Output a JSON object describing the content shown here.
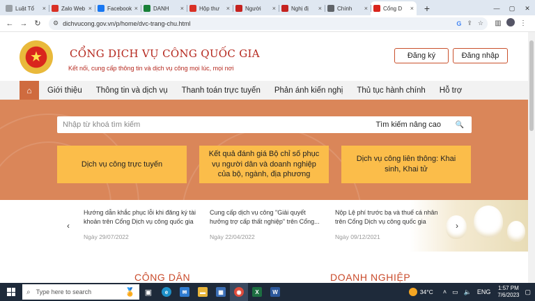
{
  "browser": {
    "tabs": [
      {
        "label": "Luật Tổ",
        "icon": "document-icon",
        "color": "#9aa0a6"
      },
      {
        "label": "Zalo Web",
        "icon": "zalo-icon",
        "color": "#d93025"
      },
      {
        "label": "Facebook",
        "icon": "facebook-icon",
        "color": "#1877f2"
      },
      {
        "label": "DANH",
        "icon": "sheets-icon",
        "color": "#188038"
      },
      {
        "label": "Hộp thư",
        "icon": "gmail-icon",
        "color": "#d93025"
      },
      {
        "label": "Người",
        "icon": "block-icon",
        "color": "#c5221f"
      },
      {
        "label": "Nghị đị",
        "icon": "block-icon",
        "color": "#c5221f"
      },
      {
        "label": "Chính",
        "icon": "globe-icon",
        "color": "#5f6368"
      },
      {
        "label": "Cổng D",
        "icon": "emblem-icon",
        "color": "#d9251d",
        "active": true
      }
    ],
    "new_tab": "+",
    "url": "dichvucong.gov.vn/p/home/dvc-trang-chu.html"
  },
  "site": {
    "brand": {
      "title": "CỔNG DỊCH VỤ CÔNG QUỐC GIA",
      "tagline": "Kết nối, cung cấp thông tin và dịch vụ công mọi lúc, mọi nơi"
    },
    "auth": {
      "register": "Đăng ký",
      "login": "Đăng nhập"
    },
    "nav": [
      "Giới thiệu",
      "Thông tin và dịch vụ",
      "Thanh toán trực tuyến",
      "Phản ánh kiến nghị",
      "Thủ tục hành chính",
      "Hỗ trợ"
    ],
    "search": {
      "placeholder": "Nhập từ khoá tìm kiếm",
      "advanced": "Tìm kiếm nâng cao"
    },
    "cards": [
      "Dịch vụ công trực tuyến",
      "Kết quả đánh giá Bộ chỉ số phục vụ người dân và doanh nghiệp của bộ, ngành, địa phương",
      "Dịch vụ công liên thông: Khai sinh, Khai tử"
    ],
    "news": [
      {
        "title": "Hướng dẫn khắc phục lỗi khi đăng ký tài khoản trên Cổng Dịch vụ công quốc gia",
        "date": "Ngày 29/07/2022"
      },
      {
        "title": "Cung cấp dịch vụ công \"Giải quyết hưởng trợ cấp thất nghiệp\" trên Cổng...",
        "date": "Ngày 22/04/2022"
      },
      {
        "title": "Nộp Lệ phí trước bạ và thuế cá nhân trên Cổng Dịch vụ công quốc gia",
        "date": "Ngày 09/12/2021"
      }
    ],
    "sections": {
      "citizen": "CÔNG DÂN",
      "business": "DOANH NGHIỆP"
    }
  },
  "taskbar": {
    "search_placeholder": "Type here to search",
    "weather": "34°C",
    "language": "ENG",
    "time": "1:57 PM",
    "date": "7/6/2023"
  },
  "colors": {
    "brand": "#b5281e",
    "hero": "#da8659",
    "card": "#fbbd4a",
    "nav_home": "#cf6b3f"
  }
}
